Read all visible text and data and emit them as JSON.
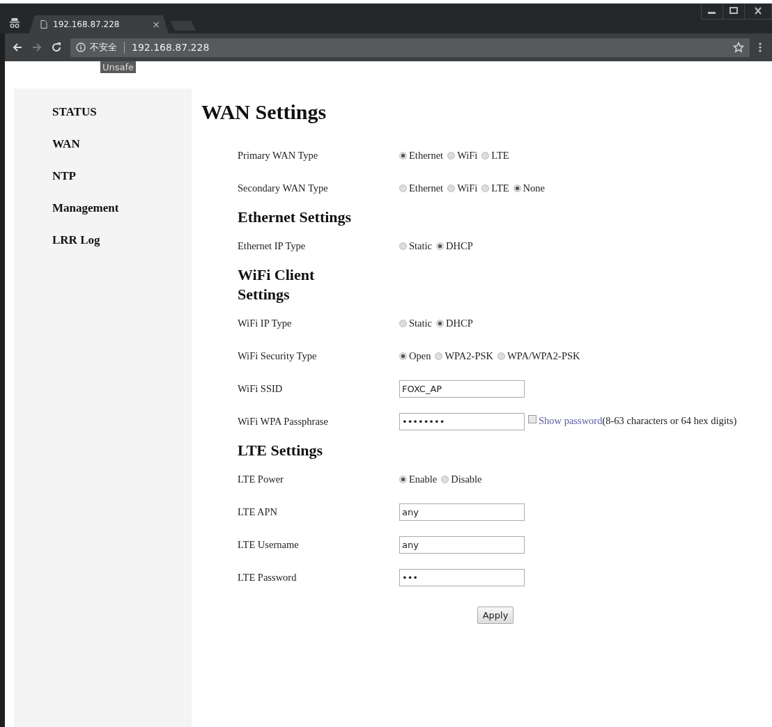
{
  "browser": {
    "tab": {
      "title": "192.168.87.228",
      "close": "×"
    },
    "address": {
      "security": "不安全",
      "url": "192.168.87.228"
    },
    "tooltip": "Unsafe"
  },
  "sidebar": {
    "items": [
      {
        "label": "STATUS"
      },
      {
        "label": "WAN"
      },
      {
        "label": "NTP"
      },
      {
        "label": "Management"
      },
      {
        "label": "LRR Log"
      }
    ]
  },
  "page": {
    "title": "WAN Settings"
  },
  "form": [
    {
      "kind": "radio",
      "label": "Primary WAN Type",
      "options": [
        {
          "label": "Ethernet",
          "selected": true
        },
        {
          "label": "WiFi",
          "selected": false
        },
        {
          "label": "LTE",
          "selected": false
        }
      ]
    },
    {
      "kind": "radio",
      "label": "Secondary WAN Type",
      "options": [
        {
          "label": "Ethernet",
          "selected": false
        },
        {
          "label": "WiFi",
          "selected": false
        },
        {
          "label": "LTE",
          "selected": false
        },
        {
          "label": "None",
          "selected": true
        }
      ]
    },
    {
      "kind": "heading",
      "label": "Ethernet Settings"
    },
    {
      "kind": "radio",
      "label": "Ethernet IP Type",
      "options": [
        {
          "label": "Static",
          "selected": false
        },
        {
          "label": "DHCP",
          "selected": true
        }
      ]
    },
    {
      "kind": "heading",
      "label": "WiFi Client Settings"
    },
    {
      "kind": "radio",
      "label": "WiFi IP Type",
      "options": [
        {
          "label": "Static",
          "selected": false
        },
        {
          "label": "DHCP",
          "selected": true
        }
      ]
    },
    {
      "kind": "radio",
      "label": "WiFi Security Type",
      "options": [
        {
          "label": "Open",
          "selected": true
        },
        {
          "label": "WPA2-PSK",
          "selected": false
        },
        {
          "label": "WPA/WPA2-PSK",
          "selected": false
        }
      ]
    },
    {
      "kind": "text",
      "label": "WiFi SSID",
      "value": "FOXC_AP"
    },
    {
      "kind": "password",
      "label": "WiFi WPA Passphrase",
      "value": "••••••••",
      "show_password": {
        "label": "Show password",
        "checked": false
      },
      "note": "(8-63 characters or 64 hex digits)"
    },
    {
      "kind": "heading",
      "label": "LTE Settings"
    },
    {
      "kind": "radio",
      "label": "LTE Power",
      "options": [
        {
          "label": "Enable",
          "selected": true
        },
        {
          "label": "Disable",
          "selected": false
        }
      ]
    },
    {
      "kind": "text",
      "label": "LTE APN",
      "value": "any"
    },
    {
      "kind": "text",
      "label": "LTE Username",
      "value": "any"
    },
    {
      "kind": "text",
      "label": "LTE Password",
      "value": "•••"
    }
  ],
  "buttons": [
    "Apply"
  ]
}
